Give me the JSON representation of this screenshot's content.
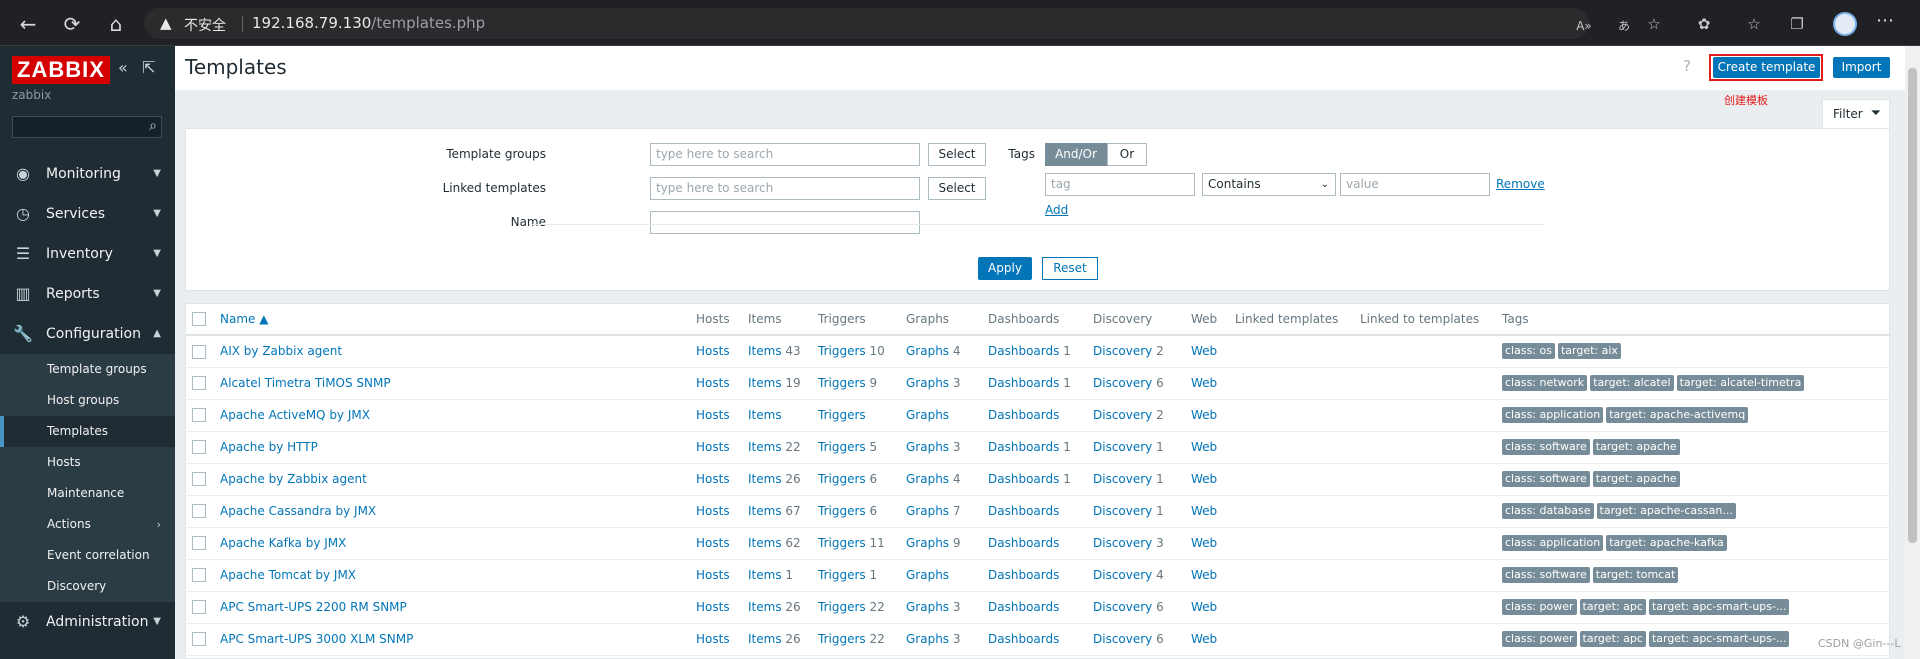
{
  "browser": {
    "insecure_label": "不安全",
    "url_host": "192.168.79.130",
    "url_path": "/templates.php"
  },
  "sidebar": {
    "logo": "ZABBIX",
    "server": "zabbix",
    "menu": [
      {
        "label": "Monitoring",
        "icon": "eye-icon"
      },
      {
        "label": "Services",
        "icon": "stopwatch-icon"
      },
      {
        "label": "Inventory",
        "icon": "list-icon"
      },
      {
        "label": "Reports",
        "icon": "bar-chart-icon"
      },
      {
        "label": "Configuration",
        "icon": "wrench-icon"
      }
    ],
    "submenu": [
      {
        "label": "Template groups"
      },
      {
        "label": "Host groups"
      },
      {
        "label": "Templates"
      },
      {
        "label": "Hosts"
      },
      {
        "label": "Maintenance"
      },
      {
        "label": "Actions"
      },
      {
        "label": "Event correlation"
      },
      {
        "label": "Discovery"
      }
    ],
    "admin": {
      "label": "Administration",
      "icon": "gear-icon"
    }
  },
  "header": {
    "title": "Templates",
    "help": "?",
    "create_label": "Create template",
    "import_label": "Import",
    "annotation": "创建模板"
  },
  "filter": {
    "tab_label": "Filter",
    "template_groups_label": "Template groups",
    "linked_templates_label": "Linked templates",
    "name_label": "Name",
    "search_placeholder": "type here to search",
    "select_label": "Select",
    "tags_label": "Tags",
    "andor_label": "And/Or",
    "or_label": "Or",
    "tag_placeholder": "tag",
    "operator_value": "Contains",
    "value_placeholder": "value",
    "remove_label": "Remove",
    "add_label": "Add",
    "apply_label": "Apply",
    "reset_label": "Reset"
  },
  "table": {
    "columns": [
      "Name ▲",
      "Hosts",
      "Items",
      "Triggers",
      "Graphs",
      "Dashboards",
      "Discovery",
      "Web",
      "Linked templates",
      "Linked to templates",
      "Tags"
    ],
    "rows": [
      {
        "name": "AIX by Zabbix agent",
        "hosts": "Hosts",
        "items": "Items",
        "items_n": "43",
        "triggers": "Triggers",
        "triggers_n": "10",
        "graphs": "Graphs",
        "graphs_n": "4",
        "dashboards": "Dashboards",
        "dashboards_n": "1",
        "discovery": "Discovery",
        "discovery_n": "2",
        "web": "Web",
        "tags": [
          "class: os",
          "target: aix"
        ]
      },
      {
        "name": "Alcatel Timetra TiMOS SNMP",
        "hosts": "Hosts",
        "items": "Items",
        "items_n": "19",
        "triggers": "Triggers",
        "triggers_n": "9",
        "graphs": "Graphs",
        "graphs_n": "3",
        "dashboards": "Dashboards",
        "dashboards_n": "1",
        "discovery": "Discovery",
        "discovery_n": "6",
        "web": "Web",
        "tags": [
          "class: network",
          "target: alcatel",
          "target: alcatel-timetra"
        ]
      },
      {
        "name": "Apache ActiveMQ by JMX",
        "hosts": "Hosts",
        "items": "Items",
        "items_n": "",
        "triggers": "Triggers",
        "triggers_n": "",
        "graphs": "Graphs",
        "graphs_n": "",
        "dashboards": "Dashboards",
        "dashboards_n": "",
        "discovery": "Discovery",
        "discovery_n": "2",
        "web": "Web",
        "tags": [
          "class: application",
          "target: apache-activemq"
        ]
      },
      {
        "name": "Apache by HTTP",
        "hosts": "Hosts",
        "items": "Items",
        "items_n": "22",
        "triggers": "Triggers",
        "triggers_n": "5",
        "graphs": "Graphs",
        "graphs_n": "3",
        "dashboards": "Dashboards",
        "dashboards_n": "1",
        "discovery": "Discovery",
        "discovery_n": "1",
        "web": "Web",
        "tags": [
          "class: software",
          "target: apache"
        ]
      },
      {
        "name": "Apache by Zabbix agent",
        "hosts": "Hosts",
        "items": "Items",
        "items_n": "26",
        "triggers": "Triggers",
        "triggers_n": "6",
        "graphs": "Graphs",
        "graphs_n": "4",
        "dashboards": "Dashboards",
        "dashboards_n": "1",
        "discovery": "Discovery",
        "discovery_n": "1",
        "web": "Web",
        "tags": [
          "class: software",
          "target: apache"
        ]
      },
      {
        "name": "Apache Cassandra by JMX",
        "hosts": "Hosts",
        "items": "Items",
        "items_n": "67",
        "triggers": "Triggers",
        "triggers_n": "6",
        "graphs": "Graphs",
        "graphs_n": "7",
        "dashboards": "Dashboards",
        "dashboards_n": "",
        "discovery": "Discovery",
        "discovery_n": "1",
        "web": "Web",
        "tags": [
          "class: database",
          "target: apache-cassan..."
        ]
      },
      {
        "name": "Apache Kafka by JMX",
        "hosts": "Hosts",
        "items": "Items",
        "items_n": "62",
        "triggers": "Triggers",
        "triggers_n": "11",
        "graphs": "Graphs",
        "graphs_n": "9",
        "dashboards": "Dashboards",
        "dashboards_n": "",
        "discovery": "Discovery",
        "discovery_n": "3",
        "web": "Web",
        "tags": [
          "class: application",
          "target: apache-kafka"
        ]
      },
      {
        "name": "Apache Tomcat by JMX",
        "hosts": "Hosts",
        "items": "Items",
        "items_n": "1",
        "triggers": "Triggers",
        "triggers_n": "1",
        "graphs": "Graphs",
        "graphs_n": "",
        "dashboards": "Dashboards",
        "dashboards_n": "",
        "discovery": "Discovery",
        "discovery_n": "4",
        "web": "Web",
        "tags": [
          "class: software",
          "target: tomcat"
        ]
      },
      {
        "name": "APC Smart-UPS 2200 RM SNMP",
        "hosts": "Hosts",
        "items": "Items",
        "items_n": "26",
        "triggers": "Triggers",
        "triggers_n": "22",
        "graphs": "Graphs",
        "graphs_n": "3",
        "dashboards": "Dashboards",
        "dashboards_n": "",
        "discovery": "Discovery",
        "discovery_n": "6",
        "web": "Web",
        "tags": [
          "class: power",
          "target: apc",
          "target: apc-smart-ups-..."
        ]
      },
      {
        "name": "APC Smart-UPS 3000 XLM SNMP",
        "hosts": "Hosts",
        "items": "Items",
        "items_n": "26",
        "triggers": "Triggers",
        "triggers_n": "22",
        "graphs": "Graphs",
        "graphs_n": "3",
        "dashboards": "Dashboards",
        "dashboards_n": "",
        "discovery": "Discovery",
        "discovery_n": "6",
        "web": "Web",
        "tags": [
          "class: power",
          "target: apc",
          "target: apc-smart-ups-..."
        ]
      }
    ]
  },
  "watermark": "CSDN @Gin---L"
}
